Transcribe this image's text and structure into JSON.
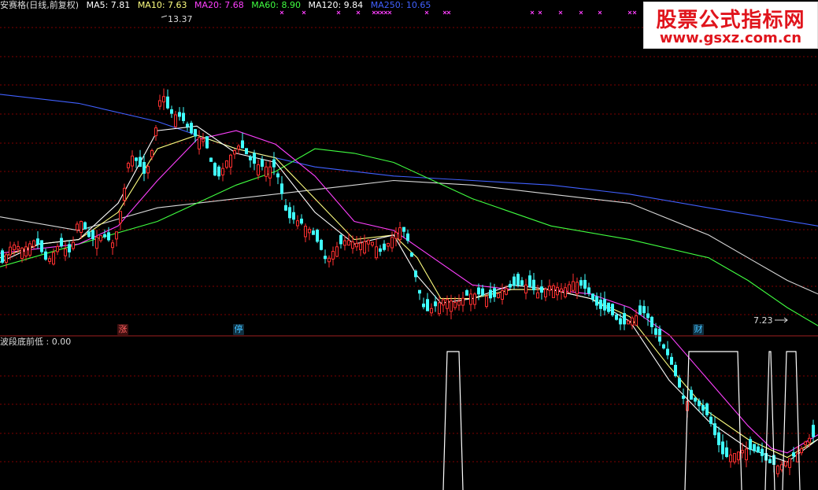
{
  "legend": {
    "title": "安赛格(日线,前复权)",
    "items": [
      {
        "text": "MA5: 7.81",
        "color": "#ffffff"
      },
      {
        "text": "MA10: 7.63",
        "color": "#ffff80"
      },
      {
        "text": "MA20: 7.68",
        "color": "#ff40ff"
      },
      {
        "text": "MA60: 8.90",
        "color": "#40ff40"
      },
      {
        "text": "MA120: 9.84",
        "color": "#ffffff"
      },
      {
        "text": "MA250: 10.65",
        "color": "#4060ff"
      }
    ]
  },
  "sub_legend": "波段底前低 : 0.00",
  "annotations": {
    "high_label": "13.37",
    "low_label": "7.23",
    "tags": [
      {
        "text": "涨",
        "color": "#ff6060",
        "bg": "#401010"
      },
      {
        "text": "停",
        "color": "#40c0ff",
        "bg": "#103040"
      },
      {
        "text": "财",
        "color": "#40c0ff",
        "bg": "#103040"
      }
    ]
  },
  "watermark": {
    "title": "股票公式指标网",
    "url": "www.gsxz.com.cn"
  },
  "chart_data": {
    "type": "candlestick",
    "colors": {
      "up": "#ff3030",
      "down": "#40ffff",
      "grid": "#800000"
    },
    "ylim": [
      6.9,
      13.9
    ],
    "price_path": [
      [
        0,
        8.3
      ],
      [
        15,
        8.8
      ],
      [
        30,
        8.7
      ],
      [
        45,
        8.9
      ],
      [
        60,
        8.4
      ],
      [
        75,
        8.8
      ],
      [
        90,
        8.6
      ],
      [
        100,
        9.4
      ],
      [
        115,
        8.9
      ],
      [
        130,
        9.0
      ],
      [
        145,
        8.8
      ],
      [
        155,
        9.7
      ],
      [
        165,
        10.8
      ],
      [
        175,
        10.6
      ],
      [
        185,
        10.3
      ],
      [
        195,
        11.0
      ],
      [
        205,
        12.2
      ],
      [
        215,
        11.7
      ],
      [
        230,
        11.6
      ],
      [
        245,
        11.2
      ],
      [
        260,
        11.1
      ],
      [
        275,
        10.2
      ],
      [
        290,
        10.7
      ],
      [
        305,
        11.0
      ],
      [
        320,
        10.6
      ],
      [
        335,
        10.5
      ],
      [
        350,
        10.5
      ],
      [
        365,
        9.4
      ],
      [
        380,
        9.3
      ],
      [
        395,
        9.1
      ],
      [
        405,
        8.8
      ],
      [
        415,
        8.4
      ],
      [
        425,
        8.7
      ],
      [
        440,
        8.9
      ],
      [
        455,
        8.8
      ],
      [
        470,
        8.9
      ],
      [
        485,
        8.6
      ],
      [
        500,
        9.0
      ],
      [
        510,
        9.2
      ],
      [
        520,
        8.8
      ],
      [
        530,
        7.9
      ],
      [
        540,
        7.3
      ],
      [
        550,
        7.4
      ],
      [
        565,
        7.6
      ],
      [
        580,
        7.5
      ],
      [
        595,
        7.7
      ],
      [
        610,
        7.7
      ],
      [
        625,
        7.6
      ],
      [
        640,
        7.8
      ],
      [
        655,
        7.9
      ],
      [
        670,
        7.9
      ],
      [
        685,
        7.7
      ],
      [
        700,
        7.9
      ],
      [
        715,
        7.8
      ],
      [
        730,
        8.0
      ],
      [
        745,
        7.8
      ],
      [
        760,
        7.4
      ],
      [
        775,
        7.3
      ],
      [
        790,
        7.0
      ],
      [
        805,
        7.2
      ],
      [
        820,
        7.3
      ],
      [
        830,
        6.9
      ],
      [
        840,
        6.6
      ],
      [
        850,
        6.3
      ],
      [
        860,
        5.8
      ],
      [
        870,
        5.3
      ],
      [
        880,
        5.4
      ],
      [
        890,
        5.2
      ],
      [
        900,
        5.0
      ],
      [
        910,
        4.5
      ],
      [
        920,
        4.1
      ],
      [
        935,
        4.2
      ],
      [
        950,
        4.3
      ],
      [
        965,
        4.2
      ],
      [
        975,
        4.0
      ],
      [
        990,
        3.9
      ],
      [
        1005,
        4.1
      ],
      [
        1015,
        4.2
      ],
      [
        1025,
        4.5
      ],
      [
        1039,
        4.6
      ]
    ],
    "ma_lines": [
      {
        "name": "MA250",
        "color": "#4060ff",
        "points": [
          [
            0,
            12.1
          ],
          [
            100,
            11.9
          ],
          [
            200,
            11.5
          ],
          [
            300,
            10.9
          ],
          [
            400,
            10.5
          ],
          [
            500,
            10.3
          ],
          [
            600,
            10.2
          ],
          [
            700,
            10.1
          ],
          [
            800,
            9.9
          ],
          [
            900,
            9.6
          ],
          [
            1039,
            9.2
          ]
        ]
      },
      {
        "name": "MA120",
        "color": "#d8d8d8",
        "points": [
          [
            0,
            9.4
          ],
          [
            100,
            9.1
          ],
          [
            200,
            9.6
          ],
          [
            300,
            9.8
          ],
          [
            400,
            10.0
          ],
          [
            450,
            10.1
          ],
          [
            500,
            10.2
          ],
          [
            600,
            10.1
          ],
          [
            700,
            9.9
          ],
          [
            800,
            9.7
          ],
          [
            900,
            9.0
          ],
          [
            950,
            8.5
          ],
          [
            1000,
            8.0
          ],
          [
            1039,
            7.7
          ]
        ]
      },
      {
        "name": "MA60",
        "color": "#40ff40",
        "points": [
          [
            0,
            8.3
          ],
          [
            100,
            8.8
          ],
          [
            200,
            9.3
          ],
          [
            300,
            10.1
          ],
          [
            350,
            10.4
          ],
          [
            400,
            10.9
          ],
          [
            450,
            10.8
          ],
          [
            500,
            10.6
          ],
          [
            550,
            10.2
          ],
          [
            600,
            9.8
          ],
          [
            700,
            9.2
          ],
          [
            800,
            8.9
          ],
          [
            900,
            8.5
          ],
          [
            950,
            8.0
          ],
          [
            1000,
            7.4
          ],
          [
            1039,
            7.0
          ]
        ]
      },
      {
        "name": "MA20",
        "color": "#ff40ff",
        "points": [
          [
            0,
            8.6
          ],
          [
            50,
            8.7
          ],
          [
            100,
            8.8
          ],
          [
            150,
            9.2
          ],
          [
            200,
            10.2
          ],
          [
            250,
            11.1
          ],
          [
            300,
            11.3
          ],
          [
            350,
            11.0
          ],
          [
            400,
            10.3
          ],
          [
            450,
            9.3
          ],
          [
            500,
            9.1
          ],
          [
            550,
            8.5
          ],
          [
            600,
            7.9
          ],
          [
            650,
            7.8
          ],
          [
            700,
            7.8
          ],
          [
            750,
            7.7
          ],
          [
            800,
            7.4
          ],
          [
            850,
            6.8
          ],
          [
            900,
            5.8
          ],
          [
            950,
            4.8
          ],
          [
            980,
            4.3
          ],
          [
            1000,
            4.2
          ],
          [
            1039,
            4.6
          ]
        ]
      },
      {
        "name": "MA10",
        "color": "#ffff80",
        "points": [
          [
            0,
            8.5
          ],
          [
            50,
            8.8
          ],
          [
            100,
            8.9
          ],
          [
            150,
            9.5
          ],
          [
            200,
            10.9
          ],
          [
            250,
            11.2
          ],
          [
            300,
            10.9
          ],
          [
            350,
            10.7
          ],
          [
            400,
            9.8
          ],
          [
            450,
            8.9
          ],
          [
            500,
            9.0
          ],
          [
            530,
            8.5
          ],
          [
            560,
            7.6
          ],
          [
            600,
            7.6
          ],
          [
            650,
            7.8
          ],
          [
            700,
            7.8
          ],
          [
            750,
            7.6
          ],
          [
            800,
            7.2
          ],
          [
            850,
            6.1
          ],
          [
            900,
            5.1
          ],
          [
            950,
            4.5
          ],
          [
            1000,
            4.1
          ],
          [
            1039,
            4.5
          ]
        ]
      },
      {
        "name": "MA5",
        "color": "#ffffff",
        "points": [
          [
            0,
            8.4
          ],
          [
            50,
            8.8
          ],
          [
            100,
            8.9
          ],
          [
            150,
            9.7
          ],
          [
            200,
            11.3
          ],
          [
            250,
            11.4
          ],
          [
            300,
            10.8
          ],
          [
            350,
            10.6
          ],
          [
            400,
            9.5
          ],
          [
            450,
            8.8
          ],
          [
            500,
            9.0
          ],
          [
            530,
            8.1
          ],
          [
            560,
            7.5
          ],
          [
            600,
            7.6
          ],
          [
            650,
            7.9
          ],
          [
            700,
            7.8
          ],
          [
            750,
            7.6
          ],
          [
            800,
            7.1
          ],
          [
            850,
            5.8
          ],
          [
            900,
            4.9
          ],
          [
            950,
            4.3
          ],
          [
            1000,
            4.0
          ],
          [
            1039,
            4.5
          ]
        ]
      }
    ],
    "signal_pulses": [
      [
        563,
        588
      ],
      [
        870,
        942
      ],
      [
        972,
        984
      ],
      [
        994,
        1016
      ]
    ]
  }
}
